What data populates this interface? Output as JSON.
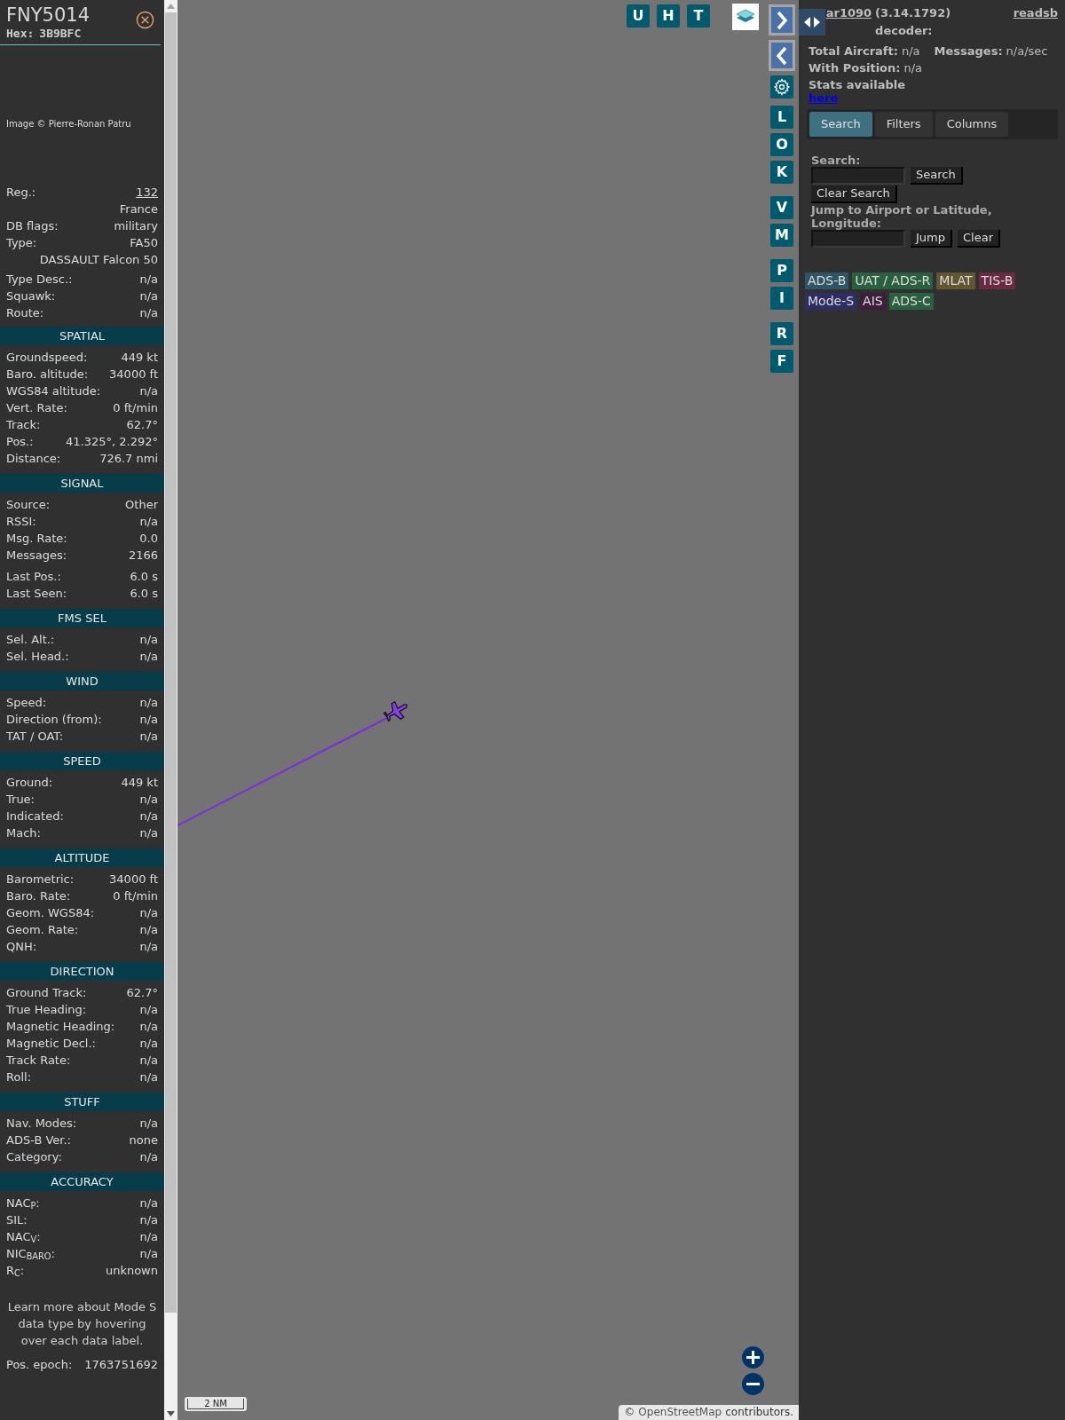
{
  "aircraft": {
    "callsign": "FNY5014",
    "hex_label": "Hex:",
    "hex": "3B9BFC",
    "photo_credit": "Image © Pierre-Ronan Patru",
    "reg_label": "Reg.:",
    "reg": "132",
    "country": "France",
    "db_flags_label": "DB flags:",
    "db_flags": "military",
    "type_label": "Type:",
    "type": "FA50",
    "type_name": "DASSAULT Falcon 50",
    "rows": [
      {
        "label": "Type Desc.:",
        "value": "n/a"
      },
      {
        "label": "Squawk:",
        "value": "n/a"
      },
      {
        "label": "Route:",
        "value": "n/a"
      }
    ]
  },
  "sections": [
    {
      "title": "SPATIAL",
      "groups": [
        [
          {
            "label": "Groundspeed:",
            "value": "449 kt"
          },
          {
            "label": "Baro. altitude:",
            "value": "34000 ft"
          },
          {
            "label": "WGS84 altitude:",
            "value": "n/a"
          },
          {
            "label": "Vert. Rate:",
            "value": "0 ft/min"
          },
          {
            "label": "Track:",
            "value": "62.7°"
          },
          {
            "label": "Pos.:",
            "value": "41.325°, 2.292°"
          },
          {
            "label": "Distance:",
            "value": "726.7 nmi"
          }
        ]
      ]
    },
    {
      "title": "SIGNAL",
      "groups": [
        [
          {
            "label": "Source:",
            "value": "Other"
          },
          {
            "label": "RSSI:",
            "value": "n/a"
          },
          {
            "label": "Msg. Rate:",
            "value": "0.0"
          },
          {
            "label": "Messages:",
            "value": "2166"
          }
        ],
        [
          {
            "label": "Last Pos.:",
            "value": "6.0 s"
          },
          {
            "label": "Last Seen:",
            "value": "6.0 s"
          }
        ]
      ]
    },
    {
      "title": "FMS SEL",
      "groups": [
        [
          {
            "label": "Sel. Alt.:",
            "value": "n/a"
          },
          {
            "label": "Sel. Head.:",
            "value": "n/a"
          }
        ]
      ]
    },
    {
      "title": "WIND",
      "groups": [
        [
          {
            "label": "Speed:",
            "value": "n/a"
          },
          {
            "label": "Direction (from):",
            "value": "n/a"
          },
          {
            "label": "TAT / OAT:",
            "value": "n/a"
          }
        ]
      ]
    },
    {
      "title": "SPEED",
      "groups": [
        [
          {
            "label": "Ground:",
            "value": "449 kt"
          },
          {
            "label": "True:",
            "value": "n/a"
          },
          {
            "label": "Indicated:",
            "value": "n/a"
          },
          {
            "label": "Mach:",
            "value": "n/a"
          }
        ]
      ]
    },
    {
      "title": "ALTITUDE",
      "groups": [
        [
          {
            "label": "Barometric:",
            "value": "34000 ft"
          },
          {
            "label": "Baro. Rate:",
            "value": "0 ft/min"
          },
          {
            "label": "Geom. WGS84:",
            "value": "n/a"
          },
          {
            "label": "Geom. Rate:",
            "value": "n/a"
          },
          {
            "label": "QNH:",
            "value": "n/a"
          }
        ]
      ]
    },
    {
      "title": "DIRECTION",
      "groups": [
        [
          {
            "label": "Ground Track:",
            "value": "62.7°"
          },
          {
            "label": "True Heading:",
            "value": "n/a"
          },
          {
            "label": "Magnetic Heading:",
            "value": "n/a"
          },
          {
            "label": "Magnetic Decl.:",
            "value": "n/a"
          },
          {
            "label": "Track Rate:",
            "value": "n/a"
          },
          {
            "label": "Roll:",
            "value": "n/a"
          }
        ]
      ]
    },
    {
      "title": "STUFF",
      "groups": [
        [
          {
            "label": "Nav. Modes:",
            "value": "n/a"
          },
          {
            "label": "ADS-B Ver.:",
            "value": "none"
          },
          {
            "label": "Category:",
            "value": "n/a"
          }
        ]
      ]
    },
    {
      "title": "ACCURACY",
      "groups": [
        [
          {
            "label": "NAC$_{P}$:",
            "value": "n/a"
          },
          {
            "label": "SIL:",
            "value": "n/a"
          },
          {
            "label": "NAC$_{V}$:",
            "value": "n/a"
          },
          {
            "label": "NIC$_{BARO}$:",
            "value": "n/a"
          },
          {
            "label": "R$_{C}$:",
            "value": "unknown"
          }
        ]
      ]
    }
  ],
  "note": "Learn more about Mode S data type by hovering over each data label.",
  "epoch": {
    "label": "Pos. epoch:",
    "value": "1763751692"
  },
  "map": {
    "top_buttons": [
      "U",
      "H",
      "T"
    ],
    "side_groups": [
      [
        "L",
        "O",
        "K"
      ],
      [
        "V",
        "M"
      ],
      [
        "P",
        "I"
      ],
      [
        "R",
        "F"
      ]
    ],
    "scale": "2 NM",
    "attribution_prefix": "©",
    "attribution_link": "OpenStreetMap",
    "attribution_suffix": "contributors."
  },
  "panel": {
    "app_link": "ar1090",
    "version": "(3.14.1792) decoder:",
    "decoder_link": "readsb",
    "stats": [
      {
        "label": "Total Aircraft:",
        "value": "n/a"
      },
      {
        "label": "Messages:",
        "value": "n/a/sec"
      },
      {
        "label": "With Position:",
        "value": "n/a"
      }
    ],
    "stats_text": "Stats available",
    "stats_link": "here",
    "tabs": [
      {
        "label": "Search",
        "selected": true
      },
      {
        "label": "Filters",
        "selected": false
      },
      {
        "label": "Columns",
        "selected": false
      }
    ],
    "search_label": "Search:",
    "search_button": "Search",
    "clear_search_button": "Clear Search",
    "jump_label": "Jump to Airport or Latitude, Longitude:",
    "jump_button": "Jump",
    "clear_button": "Clear",
    "legend": [
      {
        "label": "ADS-B",
        "color": "#2d5566"
      },
      {
        "label": "UAT / ADS-R",
        "color": "#2a6040"
      },
      {
        "label": "MLAT",
        "color": "#615632"
      },
      {
        "label": "TIS-B",
        "color": "#6a2a42"
      },
      {
        "label": "Mode-S",
        "color": "#2e2e66"
      },
      {
        "label": "AIS",
        "color": "#3e1e3e"
      },
      {
        "label": "ADS-C",
        "color": "#2a6040"
      }
    ]
  }
}
